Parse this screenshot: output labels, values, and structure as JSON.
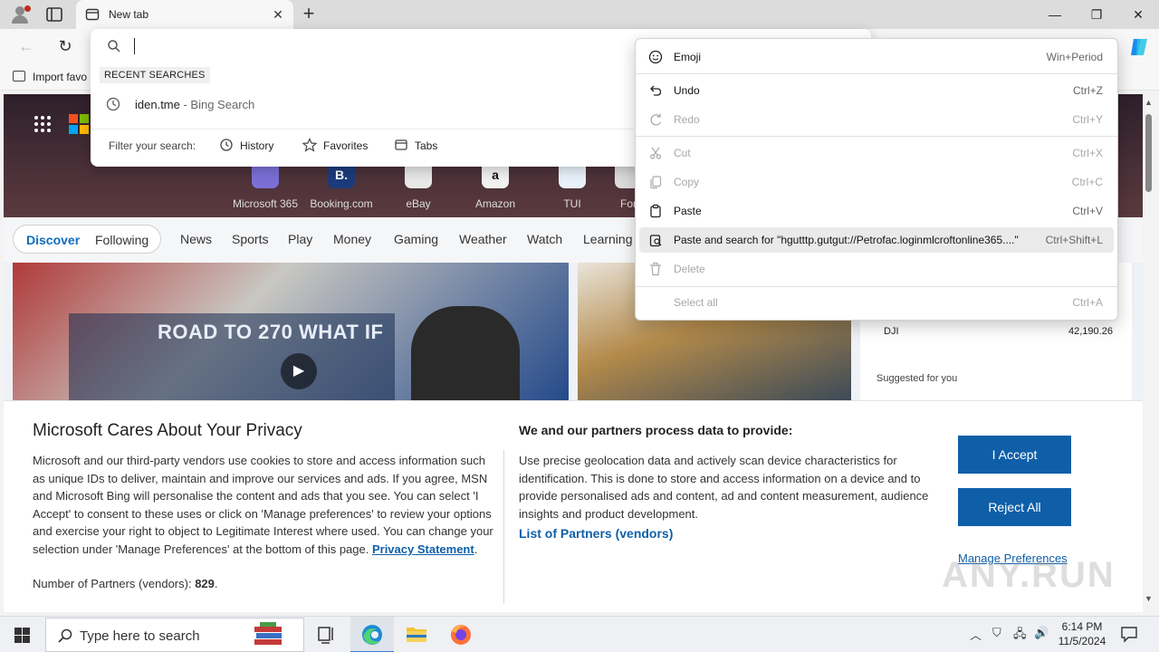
{
  "browser": {
    "tab_title": "New tab",
    "import_favorites": "Import favo"
  },
  "address_dropdown": {
    "recent_label": "RECENT SEARCHES",
    "suggestion_query": "iden.tme",
    "suggestion_source": " - Bing Search",
    "filter_label": "Filter your search:",
    "filters": [
      "History",
      "Favorites",
      "Tabs"
    ]
  },
  "context_menu": {
    "items": [
      {
        "label": "Emoji",
        "shortcut": "Win+Period",
        "disabled": false
      },
      {
        "label": "Undo",
        "shortcut": "Ctrl+Z",
        "disabled": false
      },
      {
        "label": "Redo",
        "shortcut": "Ctrl+Y",
        "disabled": true
      },
      {
        "label": "Cut",
        "shortcut": "Ctrl+X",
        "disabled": true
      },
      {
        "label": "Copy",
        "shortcut": "Ctrl+C",
        "disabled": true
      },
      {
        "label": "Paste",
        "shortcut": "Ctrl+V",
        "disabled": false
      },
      {
        "label": "Paste and search for \"hgutttp.gutgut://Petrofac.loginmlcroftonline365....\"",
        "shortcut": "Ctrl+Shift+L",
        "disabled": false
      },
      {
        "label": "Delete",
        "shortcut": "",
        "disabled": true
      },
      {
        "label": "Select all",
        "shortcut": "Ctrl+A",
        "disabled": true
      }
    ]
  },
  "new_tab_page": {
    "shortcuts": [
      "Microsoft 365",
      "Booking.com",
      "eBay",
      "Amazon",
      "TUI",
      "For"
    ],
    "shortcut_tile_text": [
      "",
      "B.",
      "",
      "a",
      "",
      ""
    ],
    "feed_tabs": {
      "discover": "Discover",
      "following": "Following"
    },
    "nav_links": [
      "News",
      "Sports",
      "Play",
      "Money",
      "Gaming",
      "Weather",
      "Watch",
      "Learning"
    ],
    "hero_banner": "ROAD TO 270 WHAT IF",
    "market": {
      "symbol": "DJI",
      "value": "42,190.26",
      "suggested": "Suggested for you"
    }
  },
  "privacy_banner": {
    "title": "Microsoft Cares About Your Privacy",
    "body": "Microsoft and our third-party vendors use cookies to store and access information such as unique IDs to deliver, maintain and improve our services and ads. If you agree, MSN and Microsoft Bing will personalise the content and ads that you see. You can select 'I Accept' to consent to these uses or click on 'Manage preferences' to review your options and exercise your right to object to Legitimate Interest where used.  You can change your selection under 'Manage Preferences' at the bottom of this page. ",
    "privacy_link": "Privacy Statement",
    "partners_label": "Number of Partners (vendors): ",
    "partners_count": "829",
    "right_title": "We and our partners process data to provide:",
    "right_body": "Use precise geolocation data and actively scan device characteristics for identification. This is done to store and access information on a device and to provide personalised ads and content, ad and content measurement, audience insights and product development.",
    "vendors_link": "List of Partners (vendors)",
    "accept": "I Accept",
    "reject": "Reject All",
    "manage": "Manage Preferences",
    "watermark": "ANY.RUN"
  },
  "taskbar": {
    "search_placeholder": "Type here to search",
    "time": "6:14 PM",
    "date": "11/5/2024"
  },
  "colors": {
    "accent": "#0f5fa8",
    "discover": "#0f6cbd"
  }
}
